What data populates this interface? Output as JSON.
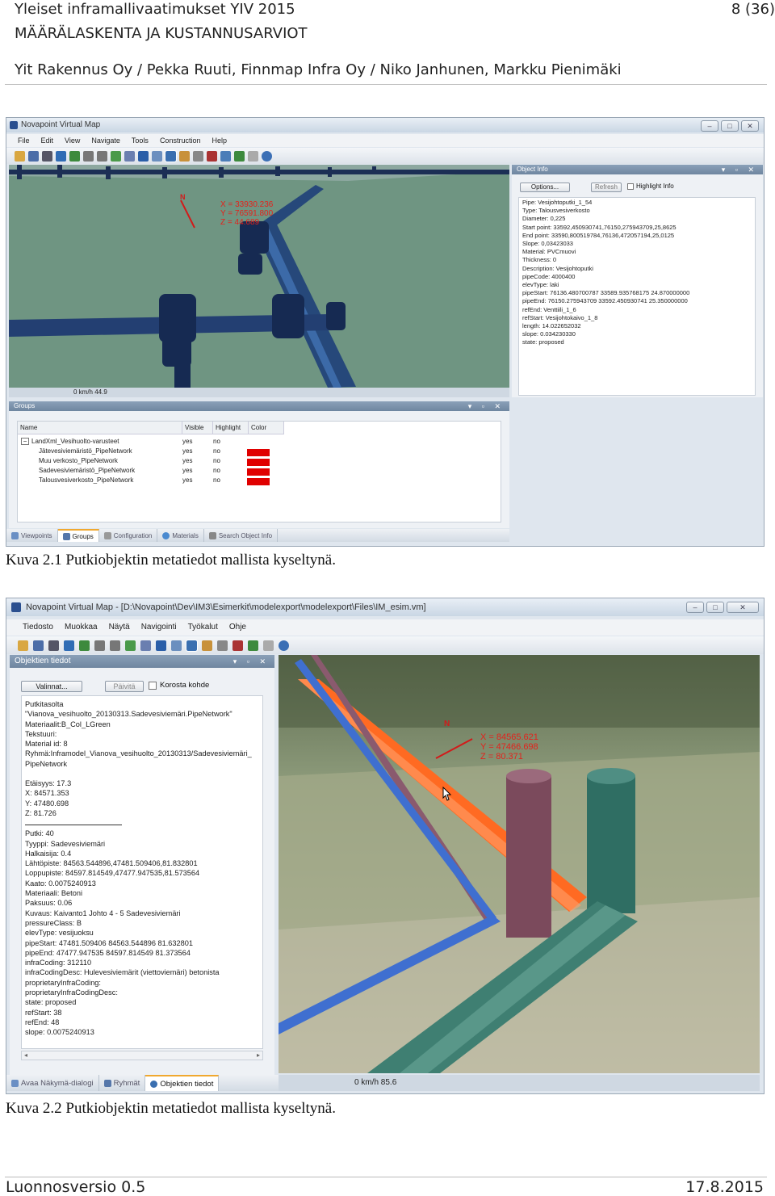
{
  "header": {
    "doc_title": "Yleiset inframallivaatimukset YIV 2015",
    "page_number": "8 (36)",
    "section_title": "MÄÄRÄLASKENTA JA KUSTANNUSARVIOT",
    "authors": "Yit Rakennus Oy / Pekka Ruuti, Finnmap Infra Oy / Niko Janhunen, Markku Pienimäki"
  },
  "figure1": {
    "caption": "Kuva 2.1 Putkiobjektin metatiedot mallista kyseltynä.",
    "window_title": "Novapoint Virtual Map",
    "menu": [
      "File",
      "Edit",
      "View",
      "Navigate",
      "Tools",
      "Construction",
      "Help"
    ],
    "compass": "N",
    "coords": [
      "X = 33930.236",
      "Y = 76591.800",
      "Z = 44.689"
    ],
    "status": "0 km/h  44.9",
    "object_info": {
      "title": "Object Info",
      "options_label": "Options...",
      "refresh_label": "Refresh",
      "highlight_label": "Highlight Info",
      "lines": [
        "Pipe: Vesijohtoputki_1_54",
        "Type: Talousvesiverkosto",
        "Diameter: 0,225",
        "Start point: 33592,450930741,76150,275943709,25,8625",
        "End point: 33590,800519784,76136,472057194,25,0125",
        "Slope: 0,03423033",
        "Material: PVCmuovi",
        "Thickness: 0",
        "Description: Vesijohtoputki",
        "pipeCode: 4000400",
        "elevType: laki",
        "pipeStart: 76136.480700787 33589.935768175 24.870000000",
        "pipeEnd: 76150.275943709 33592.450930741 25.350000000",
        "refEnd: Venttiili_1_6",
        "refStart: Vesijohtokaivo_1_8",
        "length: 14.022652032",
        "slope: 0.034230330",
        "state: proposed"
      ]
    },
    "groups": {
      "title": "Groups",
      "columns": [
        "Name",
        "Visible",
        "Highlight",
        "Color"
      ],
      "rows": [
        {
          "name": "LandXml_Vesihuolto-varusteet",
          "visible": "yes",
          "highlight": "no"
        },
        {
          "name": "Jätevesiviemäristö_PipeNetwork",
          "visible": "yes",
          "highlight": "no"
        },
        {
          "name": "Muu verkosto_PipeNetwork",
          "visible": "yes",
          "highlight": "no"
        },
        {
          "name": "Sadevesiviemäristö_PipeNetwork",
          "visible": "yes",
          "highlight": "no"
        },
        {
          "name": "Talousvesiverkosto_PipeNetwork",
          "visible": "yes",
          "highlight": "no"
        }
      ],
      "tree_toggle": "−",
      "swatch_color": "#e00000"
    },
    "tabs": [
      "Viewpoints",
      "Groups",
      "Configuration",
      "Materials",
      "Search Object Info"
    ],
    "active_tab": 1
  },
  "figure2": {
    "caption": "Kuva 2.2 Putkiobjektin metatiedot mallista kyseltynä.",
    "window_title": "Novapoint Virtual Map - [D:\\Novapoint\\Dev\\IM3\\Esimerkit\\modelexport\\modelexport\\Files\\IM_esim.vm]",
    "menu": [
      "Tiedosto",
      "Muokkaa",
      "Näytä",
      "Navigointi",
      "Työkalut",
      "Ohje"
    ],
    "panel_title": "Objektien tiedot",
    "options_label": "Valinnat...",
    "refresh_label": "Päivitä",
    "highlight_label": "Korosta kohde",
    "compass": "N",
    "coords": [
      "X = 84565.621",
      "Y = 47466.698",
      "Z = 80.371"
    ],
    "info_block1": [
      "Putkitasolta",
      "\"Vianova_vesihuolto_20130313.Sadevesiviemäri.PipeNetwork\"",
      "Materiaalit:B_Col_LGreen",
      "Tekstuuri:",
      "Material id: 8",
      "Ryhmä:Inframodel_Vianova_vesihuolto_20130313/Sadevesiviemäri_",
      "PipeNetwork"
    ],
    "info_block2": [
      "Etäisyys:    17.3",
      "X: 84571.353",
      "Y: 47480.698",
      "Z: 81.726"
    ],
    "info_block3": [
      "Putki: 40",
      "Tyyppi: Sadevesiviemäri",
      "Halkaisija: 0.4",
      "Lähtöpiste: 84563.544896,47481.509406,81.832801",
      "Loppupiste: 84597.814549,47477.947535,81.573564",
      "Kaato: 0.0075240913",
      "Materiaali: Betoni",
      "Paksuus: 0.06",
      "Kuvaus: Kaivanto1 Johto 4 - 5 Sadevesiviemäri",
      "pressureClass: B",
      "elevType: vesijuoksu",
      "pipeStart: 47481.509406 84563.544896 81.632801",
      "pipeEnd: 47477.947535 84597.814549 81.373564",
      "infraCoding: 312110",
      "infraCodingDesc: Hulevesiviemärit (viettoviemäri) betonista",
      "proprietaryInfraCoding:",
      "proprietaryInfraCodingDesc:",
      "state: proposed",
      "refStart: 38",
      "refEnd: 48",
      "slope: 0.0075240913"
    ],
    "tabs": [
      "Avaa Näkymä-dialogi",
      "Ryhmät",
      "Objektien tiedot"
    ],
    "active_tab": 2,
    "status": "0 km/h  85.6"
  },
  "footer": {
    "version": "Luonnosversio 0.5",
    "date": "17.8.2015"
  }
}
